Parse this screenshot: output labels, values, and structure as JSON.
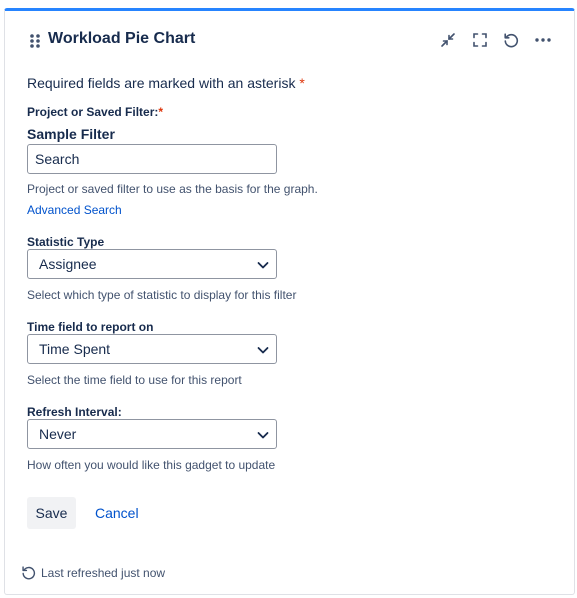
{
  "gadget": {
    "title": "Workload Pie Chart",
    "accent_color": "#2684ff",
    "header_actions": [
      {
        "icon": "minimize-icon"
      },
      {
        "icon": "fullscreen-icon"
      },
      {
        "icon": "refresh-icon"
      },
      {
        "icon": "more-icon"
      }
    ]
  },
  "form": {
    "required_note": "Required fields are marked with an asterisk",
    "required_marker": "*",
    "project_filter": {
      "label": "Project or Saved Filter:",
      "required_marker": "*",
      "selected_name": "Sample Filter",
      "search_placeholder": "Search",
      "help": "Project or saved filter to use as the basis for the graph.",
      "advanced_link": "Advanced Search"
    },
    "statistic_type": {
      "label": "Statistic Type",
      "value": "Assignee",
      "help": "Select which type of statistic to display for this filter"
    },
    "time_field": {
      "label": "Time field to report on",
      "value": "Time Spent",
      "help": "Select the time field to use for this report"
    },
    "refresh_interval": {
      "label": "Refresh Interval:",
      "value": "Never",
      "help": "How often you would like this gadget to update"
    },
    "save_label": "Save",
    "cancel_label": "Cancel"
  },
  "footer": {
    "status": "Last refreshed just now"
  },
  "colors": {
    "text": "#172b4d",
    "link": "#0052cc",
    "required": "#de350b",
    "help": "#42526e"
  }
}
